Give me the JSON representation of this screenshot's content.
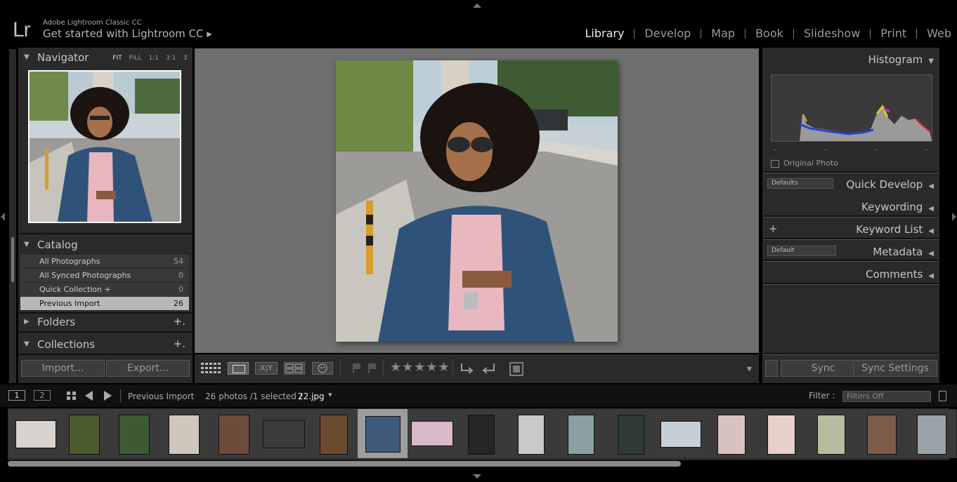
{
  "header": {
    "logo": "Lr",
    "app_name": "Adobe Lightroom Classic CC",
    "get_started": "Get started with Lightroom CC ▸",
    "modules": [
      "Library",
      "Develop",
      "Map",
      "Book",
      "Slideshow",
      "Print",
      "Web"
    ],
    "active_module": "Library"
  },
  "navigator": {
    "title": "Navigator",
    "zoom_options": [
      "FIT",
      "FILL",
      "1:1",
      "3:1"
    ],
    "zoom_arrows": "↕"
  },
  "catalog": {
    "title": "Catalog",
    "items": [
      {
        "label": "All Photographs",
        "count": "54"
      },
      {
        "label": "All Synced Photographs",
        "count": "0"
      },
      {
        "label": "Quick Collection +",
        "count": "0"
      },
      {
        "label": "Previous Import",
        "count": "26"
      }
    ]
  },
  "folders": {
    "title": "Folders",
    "plus": "+."
  },
  "collections": {
    "title": "Collections",
    "plus": "+."
  },
  "left_buttons": {
    "import": "Import...",
    "export": "Export..."
  },
  "toolbar": {
    "stars": "★★★★★",
    "compare_label": "X|Y",
    "menu_arrow": "▾"
  },
  "right_panel": {
    "histogram": "Histogram",
    "histogram_ticks": [
      "–",
      "–",
      "–",
      "–"
    ],
    "original_photo": "Original Photo",
    "quick_develop": "Quick Develop",
    "quick_develop_preset": "Defaults",
    "keywording": "Keywording",
    "keyword_list": "Keyword List",
    "keyword_plus": "+",
    "metadata": "Metadata",
    "metadata_preset": "Default",
    "comments": "Comments",
    "sync": "Sync",
    "sync_settings": "Sync Settings"
  },
  "filmstrip": {
    "page1": "1",
    "page2": "2",
    "source": "Previous Import",
    "count_text": "26 photos /1 selected /",
    "filename": "22.jpg",
    "source_arrow": "▾",
    "filter_label": "Filter :",
    "filter_value": "Filters Off",
    "selected_index": 7,
    "thumb_count": 19
  }
}
